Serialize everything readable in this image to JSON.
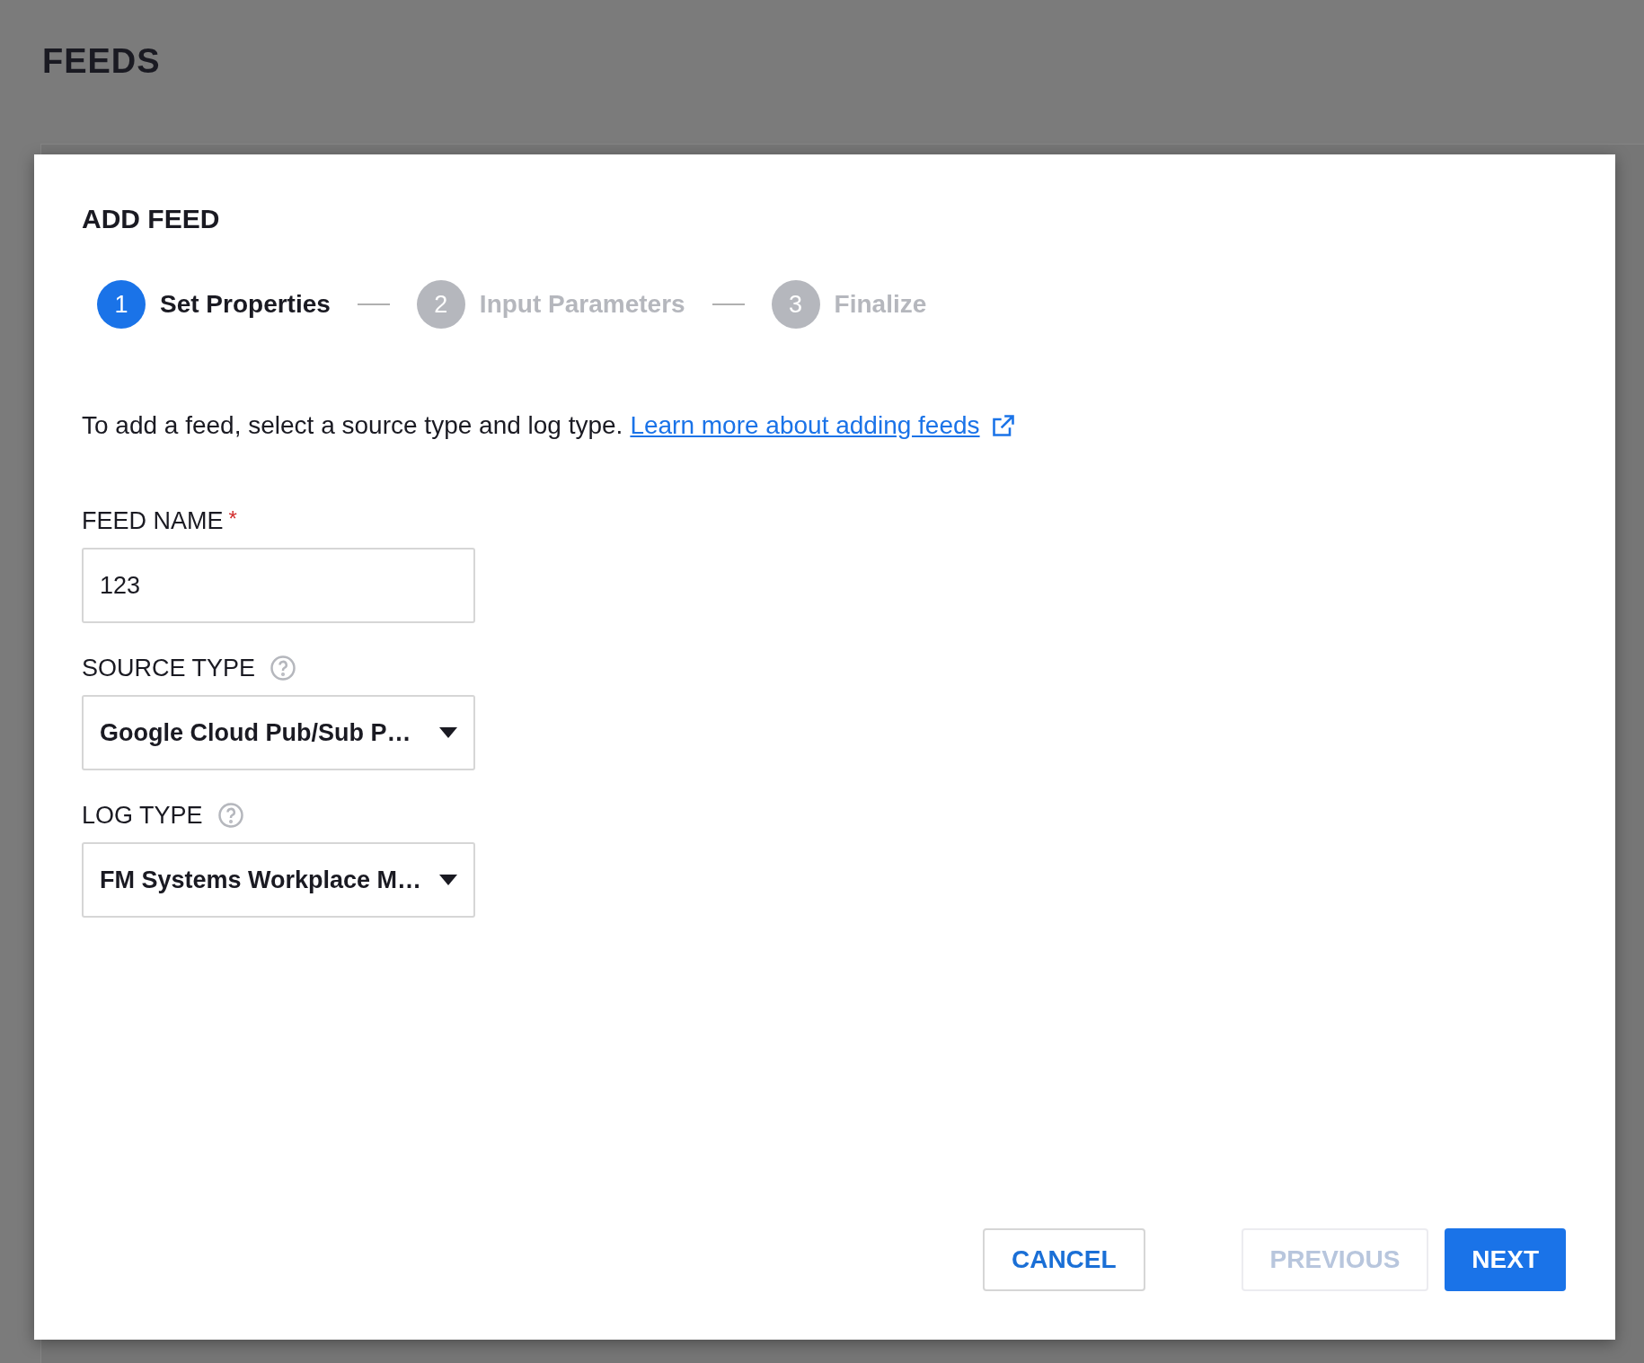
{
  "page": {
    "title": "FEEDS"
  },
  "dialog": {
    "title": "ADD FEED",
    "steps": [
      {
        "number": "1",
        "label": "Set Properties",
        "selected": true
      },
      {
        "number": "2",
        "label": "Input Parameters",
        "selected": false
      },
      {
        "number": "3",
        "label": "Finalize",
        "selected": false
      }
    ],
    "intro": {
      "text": "To add a feed, select a source type and log type.",
      "link": "Learn more about adding feeds"
    },
    "fields": [
      {
        "kind": "text",
        "label": "FEED NAME",
        "required_mark": "*",
        "help": false,
        "value": "123"
      },
      {
        "kind": "select",
        "label": "SOURCE TYPE",
        "help": true,
        "value": "Google Cloud Pub/Sub P…"
      },
      {
        "kind": "select",
        "label": "LOG TYPE",
        "help": true,
        "value": "FM Systems Workplace M…"
      }
    ],
    "buttons": [
      {
        "kind": "outline",
        "label": "CANCEL",
        "disabled": false
      },
      {
        "kind": "outline",
        "label": "PREVIOUS",
        "disabled": true
      },
      {
        "kind": "primary",
        "label": "NEXT",
        "disabled": false
      }
    ]
  }
}
